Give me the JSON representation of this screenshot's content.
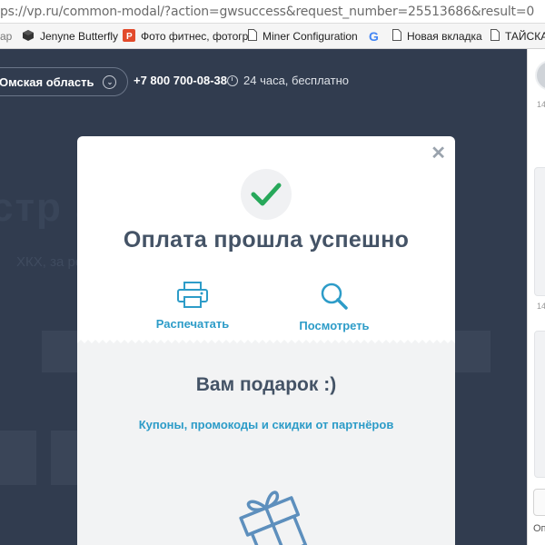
{
  "browser": {
    "url": "ps://vp.ru/common-modal/?action=gwsuccess&request_number=25513686&result=0",
    "bookmarks": [
      {
        "label": "ар",
        "icon": "bookmark-icon"
      },
      {
        "label": "Jenyne Butterfly",
        "icon": "cube-icon"
      },
      {
        "label": "Фото фитнес, фотогр",
        "icon": "p-icon"
      },
      {
        "label": "Miner Configuration",
        "icon": "page-icon"
      },
      {
        "label": "Новая вкладка",
        "icon": "page-icon"
      },
      {
        "label": "ТАЙСКА",
        "icon": "page-icon"
      }
    ]
  },
  "header": {
    "region": "Омская область",
    "phone": "+7 800 700-08-38",
    "hours": "24 часа, бесплатно"
  },
  "background": {
    "hero": "стр                                                    ан",
    "sub": "ХКХ, за                                                          рей"
  },
  "chat": {
    "times": [
      "14",
      "14"
    ],
    "operator": "Оп"
  },
  "modal": {
    "title": "Оплата прошла успешно",
    "print_label": "Распечатать",
    "view_label": "Посмотреть",
    "gift_title": "Вам подарок :)",
    "coupons_link": "Купоны, промокоды и скидки от партнёров",
    "colors": {
      "accent": "#2d9cc8",
      "check": "#27a85a",
      "title": "#445366"
    }
  }
}
